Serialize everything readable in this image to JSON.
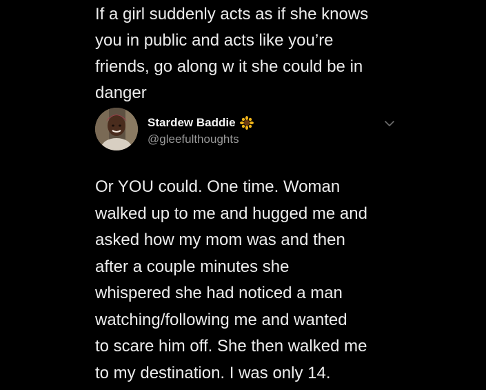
{
  "quoted_tweet": {
    "lines": [
      "If a girl suddenly acts as if she knows",
      "you in public and acts like you’re",
      "friends, go along w it she could be in",
      "danger"
    ]
  },
  "author": {
    "display_name": "Stardew Baddie",
    "handle": "@gleefulthoughts",
    "badge_icon": "sunflower-icon",
    "menu_icon": "chevron-down-icon"
  },
  "tweet": {
    "lines": [
      "Or YOU could. One time. Woman",
      "walked up to me and hugged me and",
      "asked how my mom was and then",
      "after a couple minutes she",
      "whispered she had noticed a man",
      "watching/following me and wanted",
      "to scare him off. She then walked me",
      "to my destination. I was only 14."
    ]
  },
  "colors": {
    "background": "#000000",
    "text": "#ececec",
    "handle": "#9a9a9a"
  }
}
